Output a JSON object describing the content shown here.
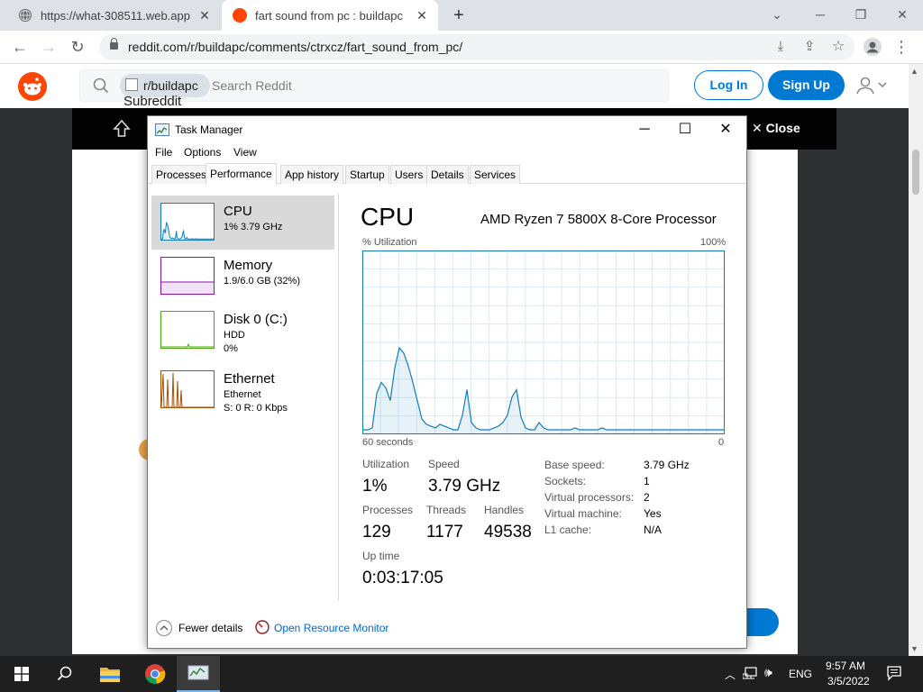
{
  "browser": {
    "tabs": [
      {
        "title": "https://what-308511.web.app",
        "active": false
      },
      {
        "title": "fart sound from pc : buildapc",
        "active": true
      }
    ],
    "url": "reddit.com/r/buildapc/comments/ctrxcz/fart_sound_from_pc/"
  },
  "reddit": {
    "subreddit_chip": "r/buildapc",
    "search_placeholder": "Search Reddit",
    "subreddit_alt": "Subreddit",
    "login_label": "Log In",
    "signup_label": "Sign Up",
    "close_label": "Close"
  },
  "taskmanager": {
    "title": "Task Manager",
    "menu": [
      "File",
      "Options",
      "View"
    ],
    "tabs": [
      "Processes",
      "Performance",
      "App history",
      "Startup",
      "Users",
      "Details",
      "Services"
    ],
    "active_tab": "Performance",
    "sidebar": [
      {
        "name": "CPU",
        "sub1": "1% 3.79 GHz",
        "sub2": "",
        "sub3": "",
        "color": "#117dbb"
      },
      {
        "name": "Memory",
        "sub1": "1.9/6.0 GB (32%)",
        "sub2": "",
        "sub3": "",
        "color": "#8b12ae"
      },
      {
        "name": "Disk 0 (C:)",
        "sub1": "HDD",
        "sub2": "0%",
        "sub3": "",
        "color": "#4da60c"
      },
      {
        "name": "Ethernet",
        "sub1": "Ethernet",
        "sub2": "S: 0 R: 0 Kbps",
        "sub3": "",
        "color": "#a74f01"
      }
    ],
    "main": {
      "title": "CPU",
      "processor": "AMD Ryzen 7 5800X 8-Core Processor",
      "util_label": "% Utilization",
      "max_label": "100%",
      "time_label": "60 seconds",
      "zero_label": "0",
      "stats": {
        "utilization_label": "Utilization",
        "utilization": "1%",
        "speed_label": "Speed",
        "speed": "3.79 GHz",
        "processes_label": "Processes",
        "processes": "129",
        "threads_label": "Threads",
        "threads": "1177",
        "handles_label": "Handles",
        "handles": "49538",
        "uptime_label": "Up time",
        "uptime": "0:03:17:05"
      },
      "right": [
        {
          "label": "Base speed:",
          "value": "3.79 GHz"
        },
        {
          "label": "Sockets:",
          "value": "1"
        },
        {
          "label": "Virtual processors:",
          "value": "2"
        },
        {
          "label": "Virtual machine:",
          "value": "Yes"
        },
        {
          "label": "L1 cache:",
          "value": "N/A"
        }
      ]
    },
    "footer": {
      "fewer": "Fewer details",
      "monitor": "Open Resource Monitor"
    },
    "cpu_history": [
      2,
      2,
      3,
      22,
      28,
      25,
      18,
      36,
      47,
      44,
      37,
      28,
      18,
      8,
      5,
      4,
      3,
      5,
      4,
      3,
      2,
      2,
      10,
      24,
      6,
      3,
      2,
      2,
      2,
      3,
      4,
      6,
      10,
      20,
      24,
      9,
      3,
      2,
      2,
      6,
      3,
      2,
      2,
      2,
      2,
      2,
      2,
      3,
      2,
      2,
      2,
      2,
      2,
      3,
      2,
      2,
      2,
      2,
      2,
      2,
      2,
      2,
      2,
      2,
      2,
      2,
      2,
      2,
      2,
      2,
      2,
      2,
      2,
      2,
      2,
      2,
      2,
      2,
      2,
      2,
      2
    ]
  },
  "tray": {
    "language": "ENG",
    "time": "9:57 AM",
    "date": "3/5/2022"
  }
}
